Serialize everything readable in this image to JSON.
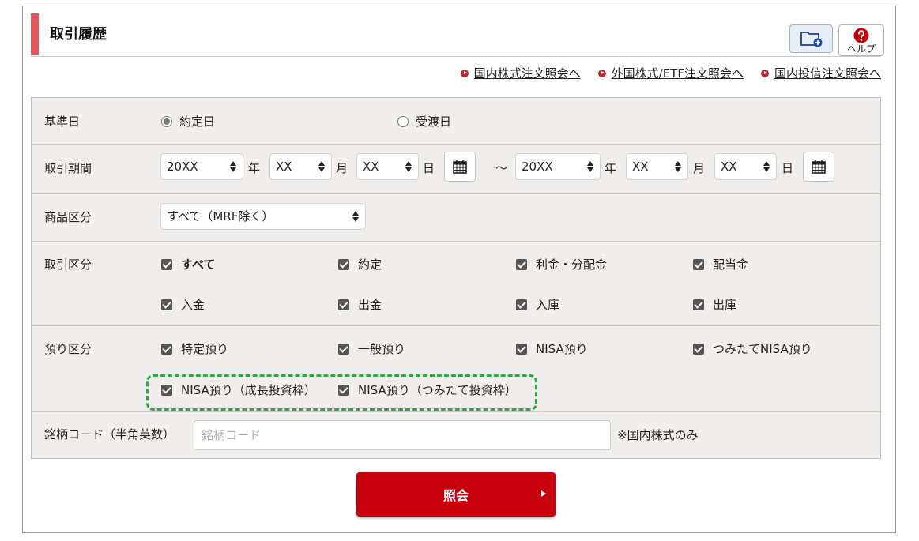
{
  "header": {
    "title": "取引履歴",
    "help_label": "ヘルプ",
    "folder_icon": "folder-plus-icon",
    "help_icon": "question-circle-icon"
  },
  "links": [
    {
      "label": "国内株式注文照会へ"
    },
    {
      "label": "外国株式/ETF注文照会へ"
    },
    {
      "label": "国内投信注文照会へ"
    }
  ],
  "form": {
    "base_date": {
      "label": "基準日",
      "options": [
        {
          "label": "約定日",
          "selected": true
        },
        {
          "label": "受渡日",
          "selected": false
        }
      ]
    },
    "period": {
      "label": "取引期間",
      "separator": "～",
      "from": {
        "year": "20XX",
        "month": "XX",
        "day": "XX"
      },
      "to": {
        "year": "20XX",
        "month": "XX",
        "day": "XX"
      },
      "year_unit": "年",
      "month_unit": "月",
      "day_unit": "日"
    },
    "product": {
      "label": "商品区分",
      "selected": "すべて（MRF除く）"
    },
    "trade_type": {
      "label": "取引区分",
      "items": [
        {
          "label": "すべて",
          "checked": true
        },
        {
          "label": "約定",
          "checked": true
        },
        {
          "label": "利金・分配金",
          "checked": true
        },
        {
          "label": "配当金",
          "checked": true
        },
        {
          "label": "入金",
          "checked": true
        },
        {
          "label": "出金",
          "checked": true
        },
        {
          "label": "入庫",
          "checked": true
        },
        {
          "label": "出庫",
          "checked": true
        }
      ]
    },
    "deposit_type": {
      "label": "預り区分",
      "items": [
        {
          "label": "特定預り",
          "checked": true
        },
        {
          "label": "一般預り",
          "checked": true
        },
        {
          "label": "NISA預り",
          "checked": true
        },
        {
          "label": "つみたてNISA預り",
          "checked": true
        },
        {
          "label": "NISA預り（成長投資枠）",
          "checked": true
        },
        {
          "label": "NISA預り（つみたて投資枠）",
          "checked": true
        }
      ]
    },
    "code": {
      "label": "銘柄コード（半角英数）",
      "value": "",
      "placeholder": "銘柄コード",
      "note": "※国内株式のみ"
    }
  },
  "submit": {
    "label": "照会"
  },
  "colors": {
    "accent": "#e0575e",
    "submit": "#c7000b",
    "highlight": "#2ea84a",
    "form_bg": "#efeeec"
  }
}
